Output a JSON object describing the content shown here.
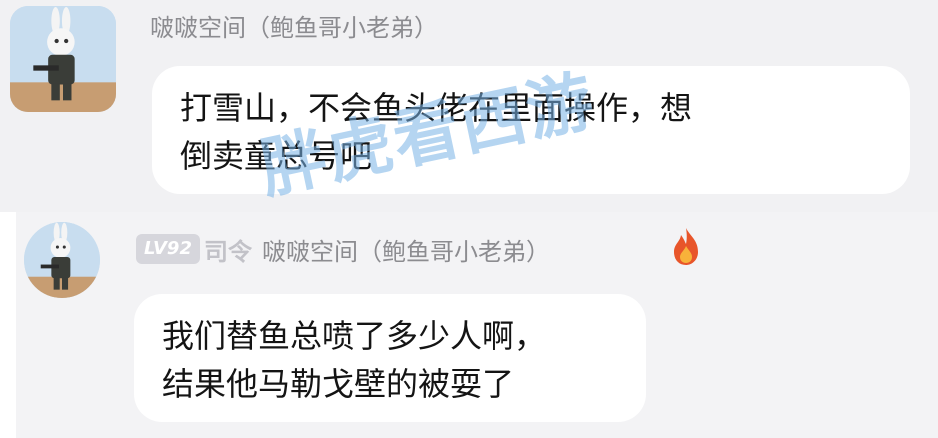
{
  "messages": [
    {
      "username": "啵啵空间（鲍鱼哥小老弟）",
      "lines": [
        "打雪山，不会鱼头佬在里面操作，想",
        "倒卖童总号吧"
      ]
    },
    {
      "level": "LV92",
      "title": "司令",
      "username": "啵啵空间（鲍鱼哥小老弟）",
      "lines": [
        "我们替鱼总喷了多少人啊，",
        "结果他马勒戈壁的被耍了"
      ]
    }
  ],
  "watermark": "胖虎看西游",
  "colors": {
    "panel_bg": "#f1f1f3",
    "bubble_bg": "#ffffff",
    "username_text": "#8c8c90",
    "watermark": "#78b2e6",
    "fire": "#e8552a"
  },
  "icons": {
    "level_badge": "level-badge-icon",
    "fire": "fire-icon",
    "avatar": "bunny-soldier-avatar"
  }
}
